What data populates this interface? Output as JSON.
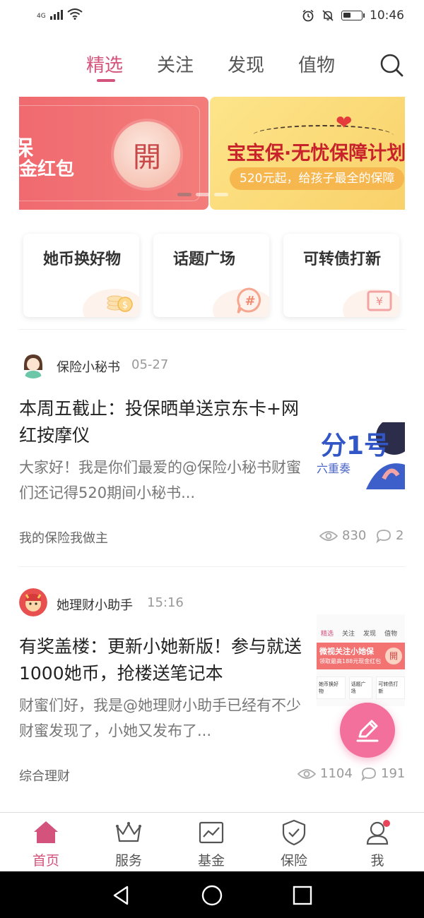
{
  "status_bar": {
    "network": "4G",
    "time": "10:46",
    "battery_level": 0.45,
    "icons": [
      "signal-icon",
      "wifi-icon",
      "alarm-icon",
      "mute-icon",
      "battery-icon"
    ]
  },
  "top_tabs": [
    {
      "label": "精选",
      "active": true
    },
    {
      "label": "关注",
      "active": false
    },
    {
      "label": "发现",
      "active": false
    },
    {
      "label": "值物",
      "active": false
    }
  ],
  "banner": {
    "slide1": {
      "line1": "保",
      "line2": "金红包",
      "button": "開"
    },
    "slide2": {
      "title": "宝宝保·无忧保障计划",
      "subtitle": "520元起，给孩子最全的保障"
    },
    "active_index": 0
  },
  "quick_cards": [
    {
      "label": "她币换好物",
      "icon": "coins-icon"
    },
    {
      "label": "话题广场",
      "icon": "hashtag-icon"
    },
    {
      "label": "可转债打新",
      "icon": "yen-icon"
    }
  ],
  "posts": [
    {
      "author": "保险小秘书",
      "time": "05-27",
      "title": "本周五截止：投保晒单送京东卡+网红按摩仪",
      "excerpt": "大家好！我是你们最爱的@保险小秘书财蜜们还记得520期间小秘书...",
      "tag": "我的保险我做主",
      "views": "830",
      "comments": "2",
      "thumb_text": "分1号",
      "thumb_sub": "六重奏"
    },
    {
      "author": "她理财小助手",
      "time": "15:16",
      "title": "有奖盖楼：更新小她新版！参与就送1000她币，抢楼送笔记本",
      "excerpt": "财蜜们好，我是@她理财小助手已经有不少财蜜发现了，小她又发布了...",
      "tag": "综合理财",
      "views": "1104",
      "comments": "191",
      "thumb_tabs": [
        "精选",
        "关注",
        "发现",
        "值物"
      ],
      "thumb_banner": "微视关注小她保",
      "thumb_banner_sub": "领取最高188元现金红包",
      "thumb_cards": [
        "她币换好物",
        "话题广场",
        "可转债打新"
      ]
    }
  ],
  "bottom_nav": [
    {
      "label": "首页",
      "icon": "home-icon",
      "active": true
    },
    {
      "label": "服务",
      "icon": "crown-icon",
      "active": false
    },
    {
      "label": "基金",
      "icon": "chart-icon",
      "active": false
    },
    {
      "label": "保险",
      "icon": "shield-icon",
      "active": false
    },
    {
      "label": "我",
      "icon": "user-icon",
      "active": false,
      "badge": true
    }
  ],
  "colors": {
    "accent": "#d4537c",
    "fab": "#f2709b",
    "banner_red": "#f06a6f",
    "banner_yellow": "#fde58a"
  }
}
